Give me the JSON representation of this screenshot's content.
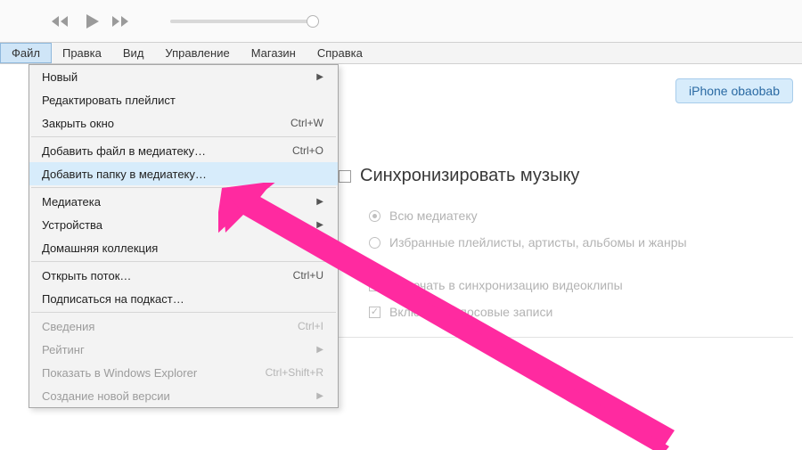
{
  "menubar": {
    "items": [
      {
        "label": "Файл",
        "active": true
      },
      {
        "label": "Правка",
        "active": false
      },
      {
        "label": "Вид",
        "active": false
      },
      {
        "label": "Управление",
        "active": false
      },
      {
        "label": "Магазин",
        "active": false
      },
      {
        "label": "Справка",
        "active": false
      }
    ]
  },
  "device": {
    "name": "iPhone obaobab"
  },
  "sync": {
    "title": "Синхронизировать музыку",
    "opt_all": "Всю медиатеку",
    "opt_selected": "Избранные плейлисты, артисты, альбомы и жанры",
    "opt_videos": "Включать в синхронизацию видеоклипы",
    "opt_voice": "Включать голосовые записи"
  },
  "menu_file": {
    "new": "Новый",
    "edit_playlist": "Редактировать плейлист",
    "close_window": {
      "label": "Закрыть окно",
      "shortcut": "Ctrl+W"
    },
    "add_file": {
      "label": "Добавить файл в медиатеку…",
      "shortcut": "Ctrl+O"
    },
    "add_folder": "Добавить папку в медиатеку…",
    "library": "Медиатека",
    "devices": "Устройства",
    "home": "Домашняя коллекция",
    "open_stream": {
      "label": "Открыть поток…",
      "shortcut": "Ctrl+U"
    },
    "subscribe": "Подписаться на подкаст…",
    "info": {
      "label": "Сведения",
      "shortcut": "Ctrl+I"
    },
    "rating": "Рейтинг",
    "show_explorer": {
      "label": "Показать в Windows Explorer",
      "shortcut": "Ctrl+Shift+R"
    },
    "new_version": "Создание новой версии"
  }
}
